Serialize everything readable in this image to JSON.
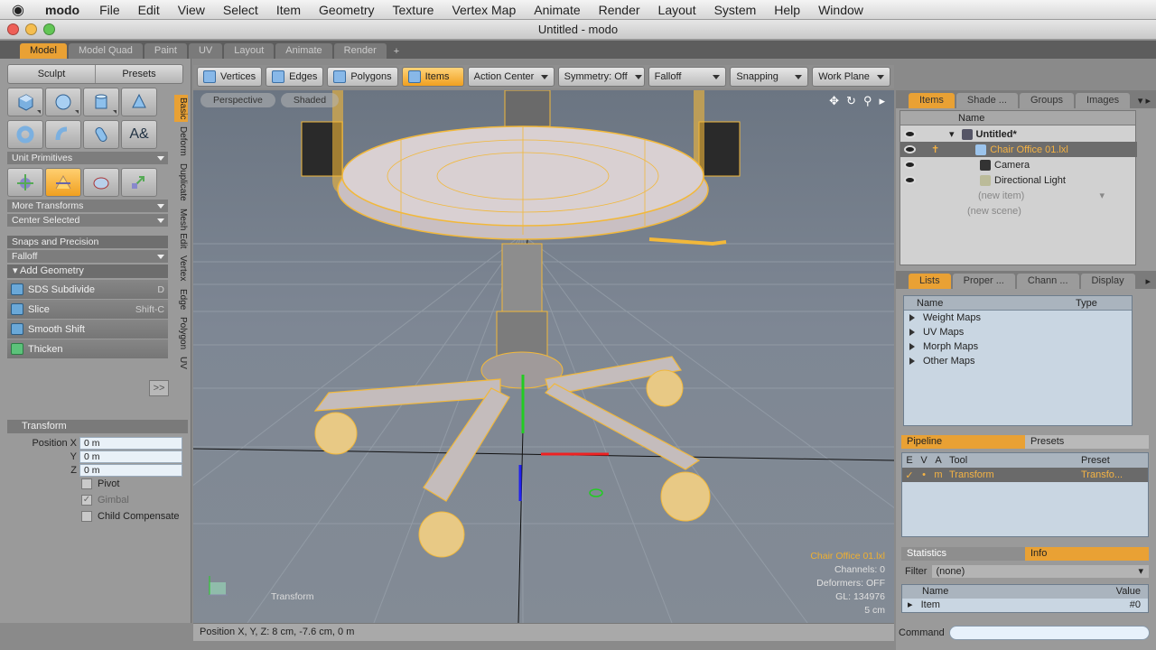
{
  "menubar": {
    "apple": "",
    "app": "modo",
    "items": [
      "File",
      "Edit",
      "View",
      "Select",
      "Item",
      "Geometry",
      "Texture",
      "Vertex Map",
      "Animate",
      "Render",
      "Layout",
      "System",
      "Help",
      "Window"
    ]
  },
  "window": {
    "title": "Untitled - modo"
  },
  "layout_tabs": [
    "Model",
    "Model Quad",
    "Paint",
    "UV",
    "Layout",
    "Animate",
    "Render",
    "+"
  ],
  "left": {
    "sculpt": "Sculpt",
    "presets": "Presets",
    "unit_primitives": "Unit Primitives",
    "more_transforms": "More Transforms",
    "center_selected": "Center Selected",
    "snaps": "Snaps and Precision",
    "falloff": "Falloff",
    "add_geometry": "Add Geometry",
    "tools": [
      {
        "label": "SDS Subdivide",
        "shortcut": "D"
      },
      {
        "label": "Slice",
        "shortcut": "Shift-C"
      },
      {
        "label": "Smooth Shift",
        "shortcut": ""
      },
      {
        "label": "Thicken",
        "shortcut": ""
      }
    ],
    "expand": ">>",
    "vtabs": [
      "Basic",
      "Deform",
      "Duplicate",
      "Mesh Edit",
      "Vertex",
      "Edge",
      "Polygon",
      "UV"
    ],
    "transform": {
      "title": "Transform",
      "pos_label": "Position X",
      "y": "Y",
      "z": "Z",
      "x_val": "0 m",
      "y_val": "0 m",
      "z_val": "0 m",
      "pivot": "Pivot",
      "gimbal": "Gimbal",
      "child": "Child Compensate"
    }
  },
  "toolbar": {
    "vertices": "Vertices",
    "edges": "Edges",
    "polygons": "Polygons",
    "items": "Items",
    "action_center": "Action Center",
    "symmetry": "Symmetry: Off",
    "falloff": "Falloff",
    "snapping": "Snapping",
    "work_plane": "Work Plane"
  },
  "viewport": {
    "perspective": "Perspective",
    "shaded": "Shaded",
    "info": {
      "item": "Chair Office 01.lxl",
      "channels": "Channels: 0",
      "deformers": "Deformers: OFF",
      "gl": "GL: 134976",
      "scale": "5 cm"
    },
    "tool_label": "Transform"
  },
  "status": "Position X, Y, Z:   8 cm, -7.6 cm, 0 m",
  "right": {
    "tabs1": [
      "Items",
      "Shade ...",
      "Groups",
      "Images"
    ],
    "name_col": "Name",
    "items": [
      "Untitled*",
      "Chair Office 01.lxl",
      "Camera",
      "Directional Light",
      "(new item)",
      "(new scene)"
    ],
    "tabs2": [
      "Lists",
      "Proper ...",
      "Chann ...",
      "Display"
    ],
    "list_cols": [
      "Name",
      "Type"
    ],
    "lists": [
      "Weight Maps",
      "UV Maps",
      "Morph Maps",
      "Other Maps"
    ],
    "pipeline_tab": "Pipeline",
    "presets_tab": "Presets",
    "pipe_cols": [
      "E",
      "V",
      "A",
      "Tool",
      "Preset"
    ],
    "pipe_row": {
      "check": "✓",
      "dot": "•",
      "m": "m",
      "tool": "Transform",
      "preset": "Transfo..."
    },
    "statistics": "Statistics",
    "info": "Info",
    "filter_label": "Filter",
    "filter_value": "(none)",
    "stat_cols": [
      "Name",
      "Value"
    ],
    "stat_row": {
      "name": "Item",
      "value": "#0"
    },
    "command": "Command"
  },
  "colors": {
    "accent": "#e9a134",
    "wire": "#f2b83a"
  }
}
